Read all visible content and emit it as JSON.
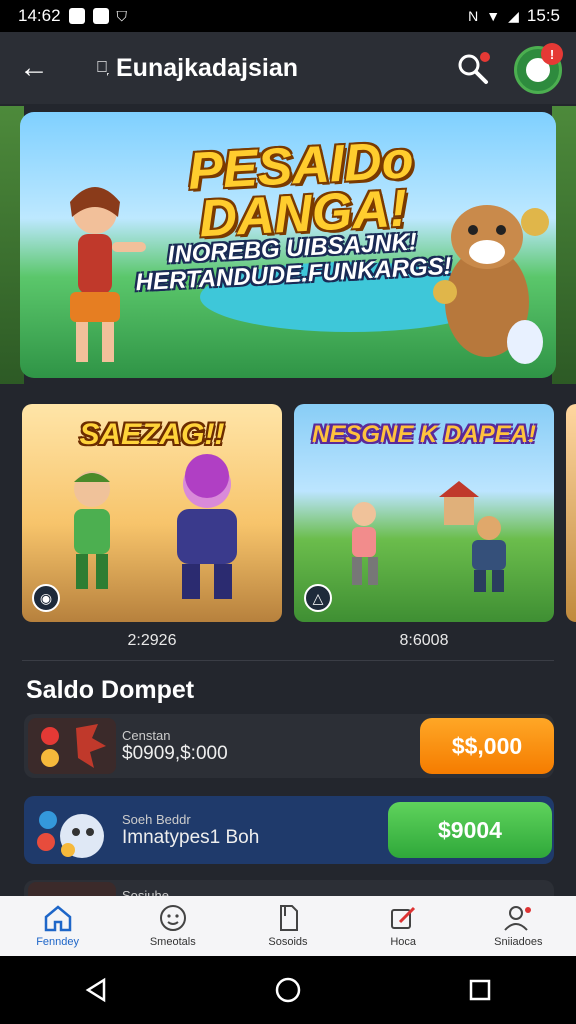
{
  "status_bar": {
    "time": "14:62",
    "right_text": "15:5"
  },
  "app_bar": {
    "title": "Eunajkadajsian",
    "title_glyph": "ᐧ᷊",
    "back_glyph": "←",
    "avatar_badge": "!"
  },
  "hero": {
    "title": "PESAIDo DANGA!",
    "subtitle": "INOREBG UIBSAJNK! HERTANDUDE.FUNKARGS!"
  },
  "games": [
    {
      "title": "SAEZAG!!",
      "count": "2:2926",
      "badge_icon": "globe-icon"
    },
    {
      "title": "NESGNE K DAPEA!",
      "count": "8:6008",
      "badge_icon": "triangle-icon"
    }
  ],
  "wallet": {
    "title": "Saldo Dompet",
    "rows": [
      {
        "small": "Censtan",
        "main": "$0909,$:000",
        "button": "$$,000"
      },
      {
        "small": "Soeh Beddr",
        "main": "Imnatypes1 Boh",
        "button": "$9004"
      },
      {
        "small": "Sosiuhe",
        "main": "",
        "button": ""
      }
    ]
  },
  "bottom_nav": [
    {
      "label": "Fenndey",
      "icon": "home-icon",
      "active": true
    },
    {
      "label": "Smeotals",
      "icon": "smiley-icon",
      "active": false
    },
    {
      "label": "Sosoids",
      "icon": "document-icon",
      "active": false
    },
    {
      "label": "Hoca",
      "icon": "edit-icon",
      "active": false
    },
    {
      "label": "Sniiadoes",
      "icon": "profile-icon",
      "active": false
    }
  ],
  "colors": {
    "accent_orange": "#f57c00",
    "accent_green": "#2fa83a",
    "nav_active": "#1e66c8",
    "wallet_blue": "#1f3a6b"
  }
}
